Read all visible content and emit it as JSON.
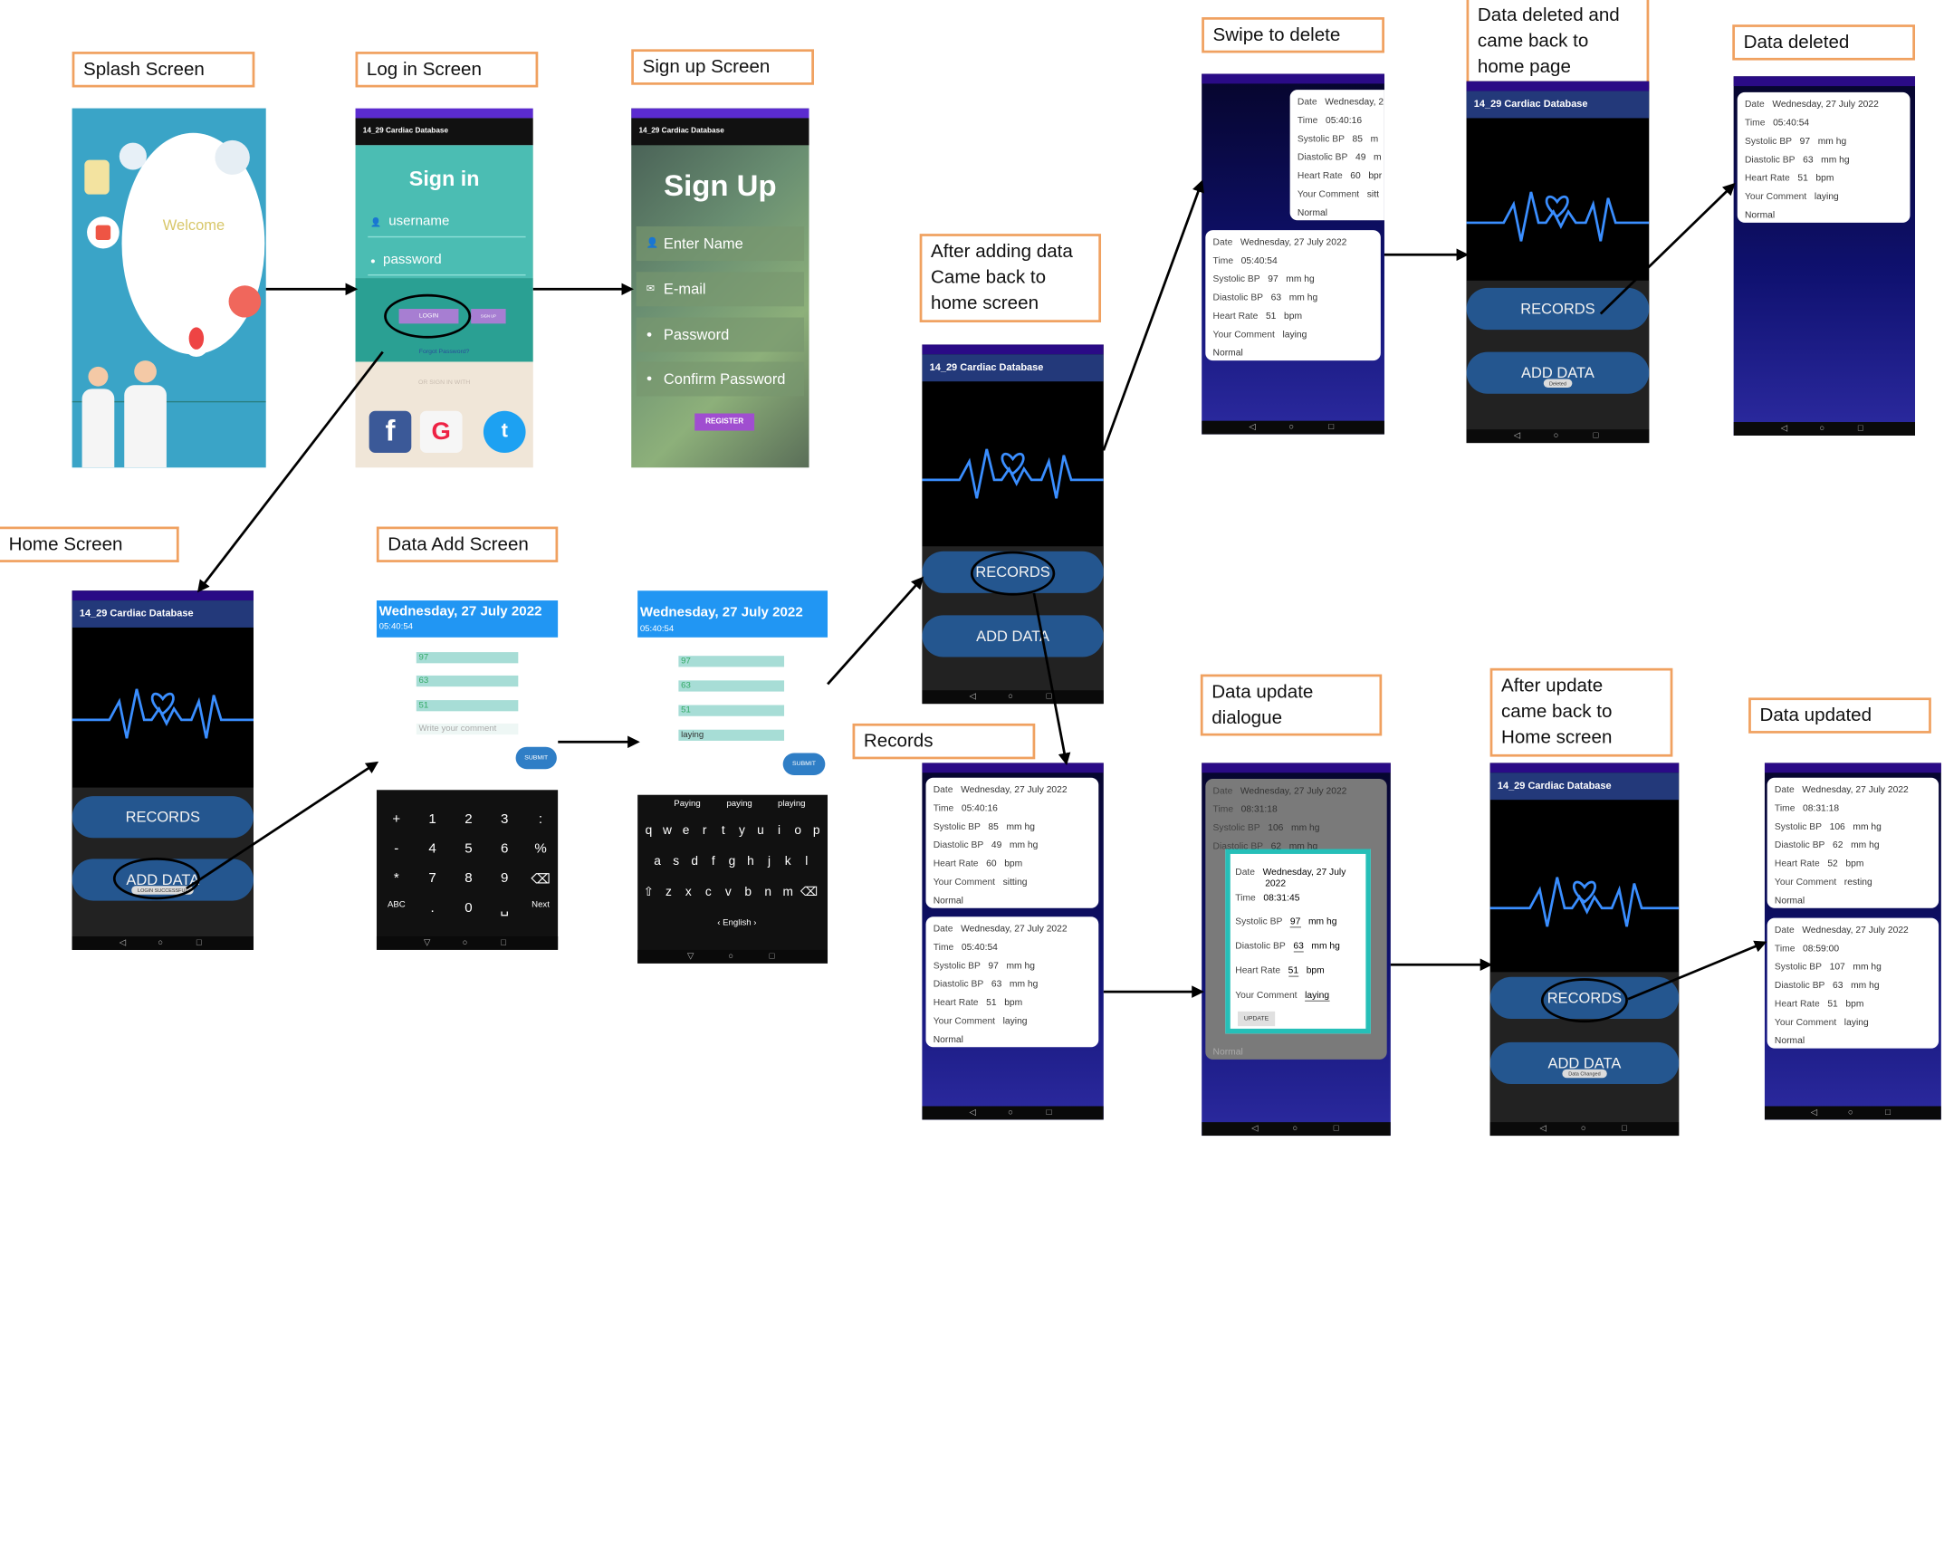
{
  "labels": {
    "splash": "Splash Screen",
    "login": "Log in Screen",
    "signup": "Sign up Screen",
    "home": "Home Screen",
    "data_add": "Data Add Screen",
    "after_adding_l1": "After adding data",
    "after_adding_l2": "Came back to",
    "after_adding_l3": "home screen",
    "swipe": "Swipe to delete",
    "deleted_back_l1": "Data deleted and",
    "deleted_back_l2": "came back to",
    "deleted_back_l3": "home page",
    "data_deleted": "Data deleted",
    "records": "Records",
    "update_dialog_l1": "Data update",
    "update_dialog_l2": "dialogue",
    "after_update_l1": "After update",
    "after_update_l2": "came back to",
    "after_update_l3": "Home screen",
    "data_updated": "Data updated"
  },
  "app": {
    "title": "14_29 Cardiac Database",
    "records_btn": "RECORDS",
    "add_btn": "ADD DATA",
    "toast_login": "LOGIN SUCCESSFUL",
    "toast_deleted": "Deleted",
    "toast_changed": "Data Changed"
  },
  "splash": {
    "welcome": "Welcome"
  },
  "login": {
    "heading": "Sign in",
    "username": "username",
    "password": "password",
    "login_btn": "LOGIN",
    "signup_btn": "SIGN UP",
    "forgot": "Forgot Password?",
    "or": "OR SIGN IN WITH"
  },
  "signup": {
    "heading": "Sign Up",
    "name": "Enter Name",
    "email": "E-mail",
    "password": "Password",
    "confirm": "Confirm Password",
    "register": "REGISTER"
  },
  "add": {
    "date": "Wednesday, 27 July 2022",
    "time": "05:40:54",
    "v1": "97",
    "v2": "63",
    "v3": "51",
    "comment_ph": "Write your comment",
    "comment": "laying",
    "submit": "SUBMIT",
    "suggest": [
      "Paying",
      "paying",
      "playing"
    ],
    "lang": "‹ English ›",
    "keys_num": [
      "+",
      "1",
      "2",
      "3",
      ":",
      "-",
      "4",
      "5",
      "6",
      "%",
      "*",
      "7",
      "8",
      "9",
      "⌫",
      "ABC",
      ".",
      "0",
      "␣",
      "Next"
    ],
    "keys_r1": [
      "q",
      "w",
      "e",
      "r",
      "t",
      "y",
      "u",
      "i",
      "o",
      "p"
    ],
    "keys_r2": [
      "a",
      "s",
      "d",
      "f",
      "g",
      "h",
      "j",
      "k",
      "l"
    ],
    "keys_r3": [
      "⇧",
      "z",
      "x",
      "c",
      "v",
      "b",
      "n",
      "m",
      "⌫"
    ]
  },
  "fields": {
    "date": "Date",
    "time": "Time",
    "sys": "Systolic BP",
    "dia": "Diastolic BP",
    "hr": "Heart Rate",
    "comment": "Your Comment",
    "mmhg": "mm hg",
    "bpm": "bpm",
    "status": "Normal"
  },
  "rec_a": {
    "date": "Wednesday, 27 July 2022",
    "time": "05:40:16",
    "sys": "85",
    "dia": "49",
    "hr": "60",
    "comment": "sitting"
  },
  "rec_b": {
    "date": "Wednesday, 27 July 2022",
    "time": "05:40:54",
    "sys": "97",
    "dia": "63",
    "hr": "51",
    "comment": "laying"
  },
  "rec_c": {
    "date": "Wednesday, 27 July 2022",
    "time": "08:31:18",
    "sys": "106",
    "dia": "62",
    "hr": "52",
    "comment": "resting"
  },
  "rec_d": {
    "date": "Wednesday, 27 July 2022",
    "time": "08:59:00",
    "sys": "107",
    "dia": "63",
    "hr": "51",
    "comment": "laying"
  },
  "swipe_a": {
    "date": "Wednesday, 2",
    "unit1": "m",
    "unit2": "m",
    "unit3": "bpr",
    "comment": "sitt"
  },
  "dialog": {
    "date_l1": "Wednesday, 27 July",
    "date_l2": "2022",
    "time": "08:31:45",
    "sys": "97",
    "dia": "63",
    "hr": "51",
    "comment": "laying",
    "update": "UPDATE",
    "bg_sys": "106",
    "bg_dia": "62"
  }
}
